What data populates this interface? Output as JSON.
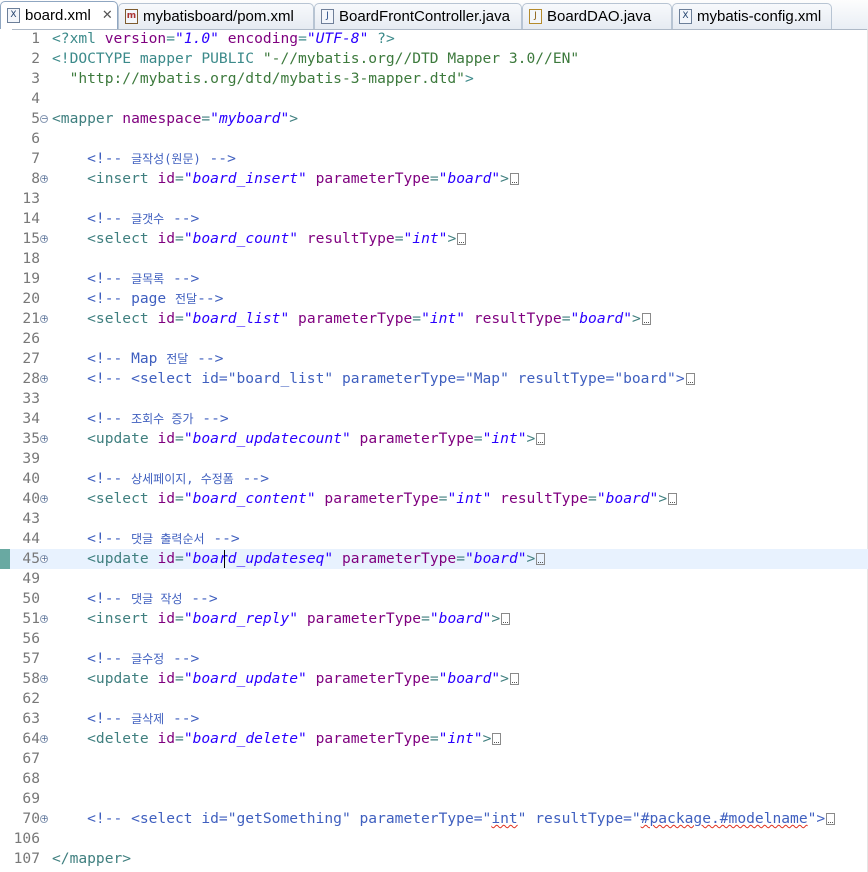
{
  "tabs": [
    {
      "label": "board.xml",
      "icon": "xml-file-icon",
      "active": true,
      "closable": true
    },
    {
      "label": "mybatisboard/pom.xml",
      "icon": "maven-file-icon",
      "active": false
    },
    {
      "label": "BoardFrontController.java",
      "icon": "java-file-icon",
      "active": false
    },
    {
      "label": "BoardDAO.java",
      "icon": "java-file-icon",
      "active": false
    },
    {
      "label": "mybatis-config.xml",
      "icon": "xml-file-icon",
      "active": false
    }
  ],
  "editor": {
    "current_line": "45",
    "lines": [
      {
        "n": "1",
        "fold": false,
        "segs": [
          [
            "c-pi",
            "<?xml "
          ],
          [
            "c-attr",
            "version"
          ],
          [
            "c-pi",
            "="
          ],
          [
            "c-val",
            "\"1.0\""
          ],
          [
            "c-pi",
            " "
          ],
          [
            "c-attr",
            "encoding"
          ],
          [
            "c-pi",
            "="
          ],
          [
            "c-val",
            "\"UTF-8\""
          ],
          [
            "c-pi",
            " ?>"
          ]
        ]
      },
      {
        "n": "2",
        "fold": false,
        "segs": [
          [
            "c-doctype",
            "<!DOCTYPE mapper PUBLIC "
          ],
          [
            "c-dtdstr",
            "\"-//mybatis.org//DTD Mapper 3.0//EN\""
          ]
        ]
      },
      {
        "n": "3",
        "fold": false,
        "segs": [
          [
            "c-dtdstr",
            "  \"http://mybatis.org/dtd/mybatis-3-mapper.dtd\""
          ],
          [
            "c-doctype",
            ">"
          ]
        ]
      },
      {
        "n": "4",
        "fold": false,
        "segs": []
      },
      {
        "n": "5",
        "fold": "minus",
        "segs": [
          [
            "c-tag",
            "<mapper "
          ],
          [
            "c-attr",
            "namespace"
          ],
          [
            "c-tag",
            "="
          ],
          [
            "c-val",
            "\"myboard\""
          ],
          [
            "c-tag",
            ">"
          ]
        ]
      },
      {
        "n": "6",
        "fold": false,
        "segs": []
      },
      {
        "n": "7",
        "fold": false,
        "segs": [
          [
            "c-comment",
            "    <!-- "
          ],
          [
            "c-comment c-ko",
            "글작성(원문)"
          ],
          [
            "c-comment",
            " -->"
          ]
        ]
      },
      {
        "n": "8",
        "fold": "plus",
        "segs": [
          [
            "c-tag",
            "    <insert "
          ],
          [
            "c-attr",
            "id"
          ],
          [
            "c-tag",
            "="
          ],
          [
            "c-val",
            "\"board_insert\""
          ],
          [
            "c-tag",
            " "
          ],
          [
            "c-attr",
            "parameterType"
          ],
          [
            "c-tag",
            "="
          ],
          [
            "c-val",
            "\"board\""
          ],
          [
            "c-tag",
            ">"
          ],
          [
            "box",
            ""
          ]
        ]
      },
      {
        "n": "13",
        "fold": false,
        "segs": []
      },
      {
        "n": "14",
        "fold": false,
        "segs": [
          [
            "c-comment",
            "    <!-- "
          ],
          [
            "c-comment c-ko",
            "글갯수"
          ],
          [
            "c-comment",
            " -->"
          ]
        ]
      },
      {
        "n": "15",
        "fold": "plus",
        "segs": [
          [
            "c-tag",
            "    <select "
          ],
          [
            "c-attr",
            "id"
          ],
          [
            "c-tag",
            "="
          ],
          [
            "c-val",
            "\"board_count\""
          ],
          [
            "c-tag",
            " "
          ],
          [
            "c-attr",
            "resultType"
          ],
          [
            "c-tag",
            "="
          ],
          [
            "c-val",
            "\"int\""
          ],
          [
            "c-tag",
            ">"
          ],
          [
            "box",
            ""
          ]
        ]
      },
      {
        "n": "18",
        "fold": false,
        "segs": []
      },
      {
        "n": "19",
        "fold": false,
        "segs": [
          [
            "c-comment",
            "    <!-- "
          ],
          [
            "c-comment c-ko",
            "글목록"
          ],
          [
            "c-comment",
            " -->"
          ]
        ]
      },
      {
        "n": "20",
        "fold": false,
        "segs": [
          [
            "c-comment",
            "    <!-- page "
          ],
          [
            "c-comment c-ko",
            "전달"
          ],
          [
            "c-comment",
            "-->"
          ]
        ]
      },
      {
        "n": "21",
        "fold": "plus",
        "segs": [
          [
            "c-tag",
            "    <select "
          ],
          [
            "c-attr",
            "id"
          ],
          [
            "c-tag",
            "="
          ],
          [
            "c-val",
            "\"board_list\""
          ],
          [
            "c-tag",
            " "
          ],
          [
            "c-attr",
            "parameterType"
          ],
          [
            "c-tag",
            "="
          ],
          [
            "c-val",
            "\"int\""
          ],
          [
            "c-tag",
            " "
          ],
          [
            "c-attr",
            "resultType"
          ],
          [
            "c-tag",
            "="
          ],
          [
            "c-val",
            "\"board\""
          ],
          [
            "c-tag",
            ">"
          ],
          [
            "box",
            ""
          ]
        ]
      },
      {
        "n": "26",
        "fold": false,
        "segs": []
      },
      {
        "n": "27",
        "fold": false,
        "segs": [
          [
            "c-comment",
            "    <!-- Map "
          ],
          [
            "c-comment c-ko",
            "전달"
          ],
          [
            "c-comment",
            " -->"
          ]
        ]
      },
      {
        "n": "28",
        "fold": "plus",
        "segs": [
          [
            "c-comment",
            "    <!-- <select id=\"board_list\" parameterType=\"Map\" resultType=\"board\">"
          ],
          [
            "box",
            ""
          ]
        ]
      },
      {
        "n": "33",
        "fold": false,
        "segs": []
      },
      {
        "n": "34",
        "fold": false,
        "segs": [
          [
            "c-comment",
            "    <!-- "
          ],
          [
            "c-comment c-ko",
            "조회수 증가"
          ],
          [
            "c-comment",
            " -->"
          ]
        ]
      },
      {
        "n": "35",
        "fold": "plus",
        "segs": [
          [
            "c-tag",
            "    <update "
          ],
          [
            "c-attr",
            "id"
          ],
          [
            "c-tag",
            "="
          ],
          [
            "c-val",
            "\"board_updatecount\""
          ],
          [
            "c-tag",
            " "
          ],
          [
            "c-attr",
            "parameterType"
          ],
          [
            "c-tag",
            "="
          ],
          [
            "c-val",
            "\"int\""
          ],
          [
            "c-tag",
            ">"
          ],
          [
            "box",
            ""
          ]
        ]
      },
      {
        "n": "39",
        "fold": false,
        "segs": []
      },
      {
        "n": "40",
        "fold": false,
        "segs": [
          [
            "c-comment",
            "    <!-- "
          ],
          [
            "c-comment c-ko",
            "상세페이지, 수정폼"
          ],
          [
            "c-comment",
            " -->"
          ]
        ]
      },
      {
        "n": "40",
        "fold": "plus",
        "segs": [
          [
            "c-tag",
            "    <select "
          ],
          [
            "c-attr",
            "id"
          ],
          [
            "c-tag",
            "="
          ],
          [
            "c-val",
            "\"board_content\""
          ],
          [
            "c-tag",
            " "
          ],
          [
            "c-attr",
            "parameterType"
          ],
          [
            "c-tag",
            "="
          ],
          [
            "c-val",
            "\"int\""
          ],
          [
            "c-tag",
            " "
          ],
          [
            "c-attr",
            "resultType"
          ],
          [
            "c-tag",
            "="
          ],
          [
            "c-val",
            "\"board\""
          ],
          [
            "c-tag",
            ">"
          ],
          [
            "box",
            ""
          ]
        ]
      },
      {
        "n": "43",
        "fold": false,
        "segs": []
      },
      {
        "n": "44",
        "fold": false,
        "segs": [
          [
            "c-comment",
            "    <!-- "
          ],
          [
            "c-comment c-ko",
            "댓글 출력순서"
          ],
          [
            "c-comment",
            " -->"
          ]
        ]
      },
      {
        "n": "45",
        "fold": "plus",
        "segs": [
          [
            "c-tag",
            "    <update "
          ],
          [
            "c-attr",
            "id"
          ],
          [
            "c-tag",
            "="
          ],
          [
            "c-val",
            "\"board_updateseq\""
          ],
          [
            "c-tag",
            " "
          ],
          [
            "c-attr",
            "parameterType"
          ],
          [
            "c-tag",
            "="
          ],
          [
            "c-val",
            "\"board\""
          ],
          [
            "c-tag",
            ">"
          ],
          [
            "box",
            ""
          ]
        ]
      },
      {
        "n": "49",
        "fold": false,
        "segs": []
      },
      {
        "n": "50",
        "fold": false,
        "segs": [
          [
            "c-comment",
            "    <!-- "
          ],
          [
            "c-comment c-ko",
            "댓글 작성"
          ],
          [
            "c-comment",
            " -->"
          ]
        ]
      },
      {
        "n": "51",
        "fold": "plus",
        "segs": [
          [
            "c-tag",
            "    <insert "
          ],
          [
            "c-attr",
            "id"
          ],
          [
            "c-tag",
            "="
          ],
          [
            "c-val",
            "\"board_reply\""
          ],
          [
            "c-tag",
            " "
          ],
          [
            "c-attr",
            "parameterType"
          ],
          [
            "c-tag",
            "="
          ],
          [
            "c-val",
            "\"board\""
          ],
          [
            "c-tag",
            ">"
          ],
          [
            "box",
            ""
          ]
        ]
      },
      {
        "n": "56",
        "fold": false,
        "segs": []
      },
      {
        "n": "57",
        "fold": false,
        "segs": [
          [
            "c-comment",
            "    <!-- "
          ],
          [
            "c-comment c-ko",
            "글수정"
          ],
          [
            "c-comment",
            " -->"
          ]
        ]
      },
      {
        "n": "58",
        "fold": "plus",
        "segs": [
          [
            "c-tag",
            "    <update "
          ],
          [
            "c-attr",
            "id"
          ],
          [
            "c-tag",
            "="
          ],
          [
            "c-val",
            "\"board_update\""
          ],
          [
            "c-tag",
            " "
          ],
          [
            "c-attr",
            "parameterType"
          ],
          [
            "c-tag",
            "="
          ],
          [
            "c-val",
            "\"board\""
          ],
          [
            "c-tag",
            ">"
          ],
          [
            "box",
            ""
          ]
        ]
      },
      {
        "n": "62",
        "fold": false,
        "segs": []
      },
      {
        "n": "63",
        "fold": false,
        "segs": [
          [
            "c-comment",
            "    <!-- "
          ],
          [
            "c-comment c-ko",
            "글삭제"
          ],
          [
            "c-comment",
            " -->"
          ]
        ]
      },
      {
        "n": "64",
        "fold": "plus",
        "segs": [
          [
            "c-tag",
            "    <delete "
          ],
          [
            "c-attr",
            "id"
          ],
          [
            "c-tag",
            "="
          ],
          [
            "c-val",
            "\"board_delete\""
          ],
          [
            "c-tag",
            " "
          ],
          [
            "c-attr",
            "parameterType"
          ],
          [
            "c-tag",
            "="
          ],
          [
            "c-val",
            "\"int\""
          ],
          [
            "c-tag",
            ">"
          ],
          [
            "box",
            ""
          ]
        ]
      },
      {
        "n": "67",
        "fold": false,
        "segs": []
      },
      {
        "n": "68",
        "fold": false,
        "segs": []
      },
      {
        "n": "69",
        "fold": false,
        "segs": []
      },
      {
        "n": "70",
        "fold": "plus",
        "segs": [
          [
            "c-comment",
            "    <!-- <select id=\"getSomething\" parameterType=\""
          ],
          [
            "c-comment squiggle",
            "int"
          ],
          [
            "c-comment",
            "\" resultType=\""
          ],
          [
            "c-comment squiggle",
            "#package.#modelname"
          ],
          [
            "c-comment",
            "\">"
          ],
          [
            "box",
            ""
          ]
        ]
      },
      {
        "n": "106",
        "fold": false,
        "segs": []
      },
      {
        "n": "107",
        "fold": false,
        "segs": [
          [
            "c-tag",
            "</mapper>"
          ]
        ]
      }
    ]
  }
}
